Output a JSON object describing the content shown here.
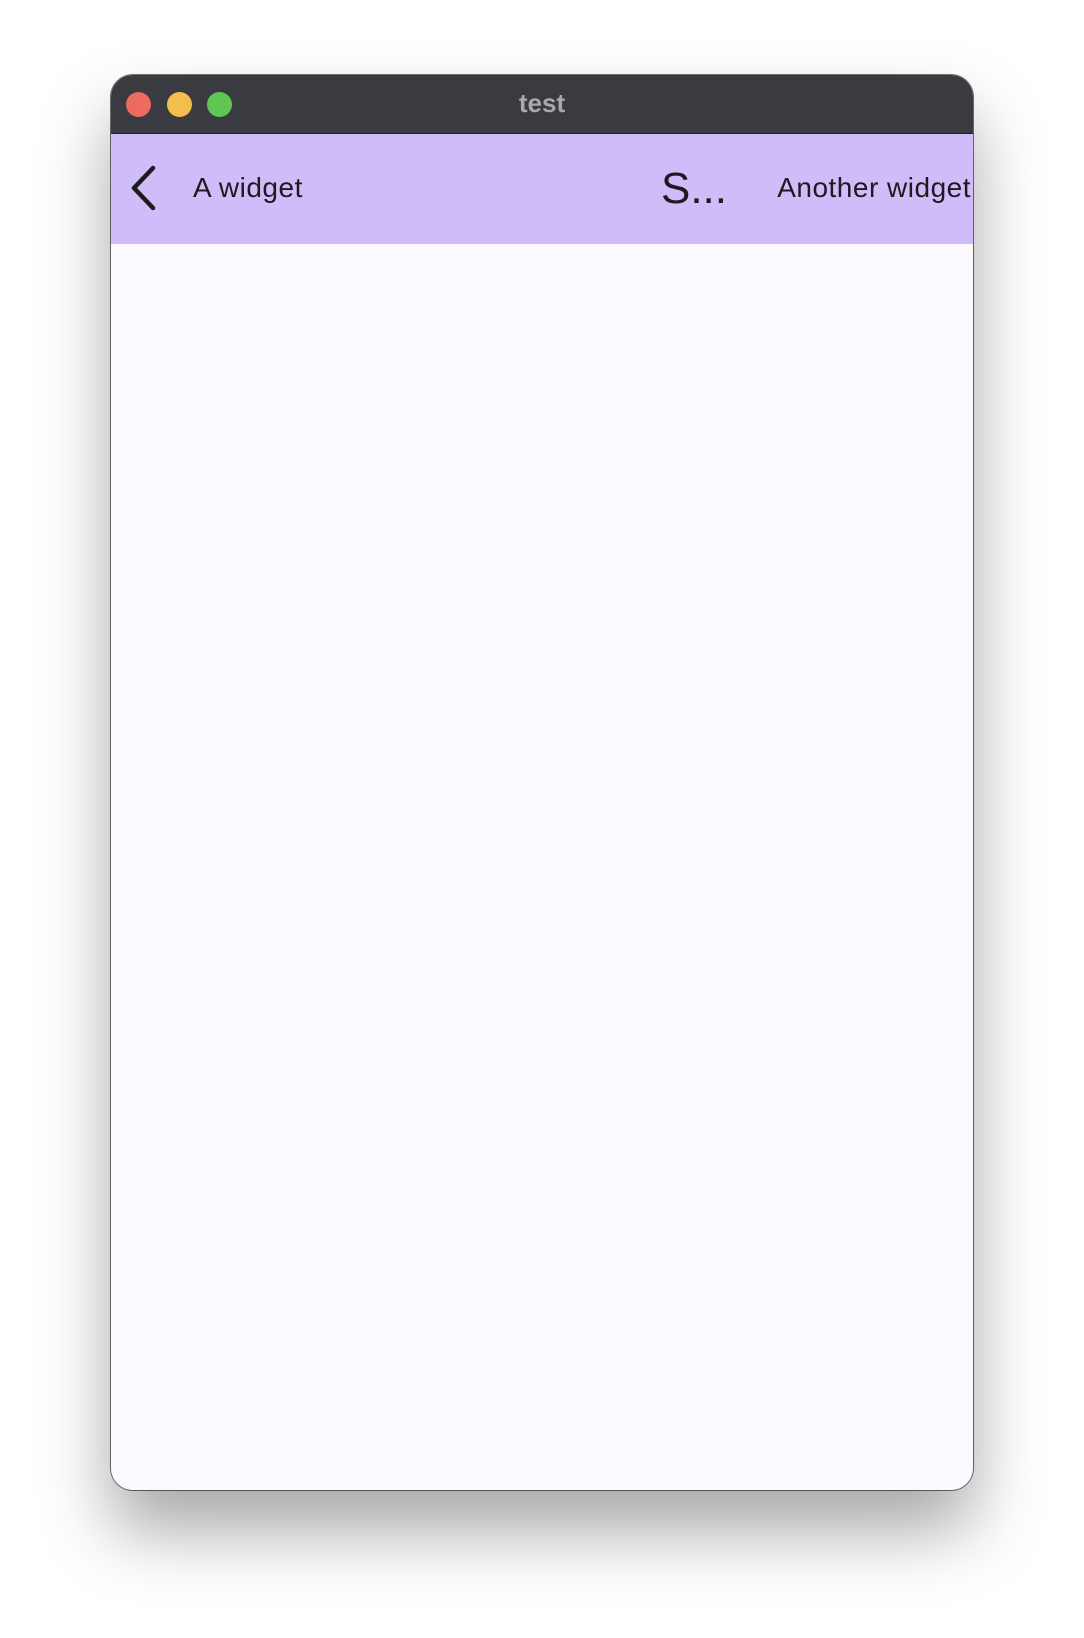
{
  "window": {
    "title": "test",
    "traffic_lights": {
      "close_color": "#ec6a5e",
      "minimize_color": "#f4be4f",
      "maximize_color": "#61c554"
    }
  },
  "appbar": {
    "background_color": "#d0bcf8",
    "back_icon": "chevron-left-icon",
    "leading_label": "A widget",
    "title": "S...",
    "action_label": "Another widget"
  },
  "body": {
    "background_color": "#fcfaff"
  }
}
